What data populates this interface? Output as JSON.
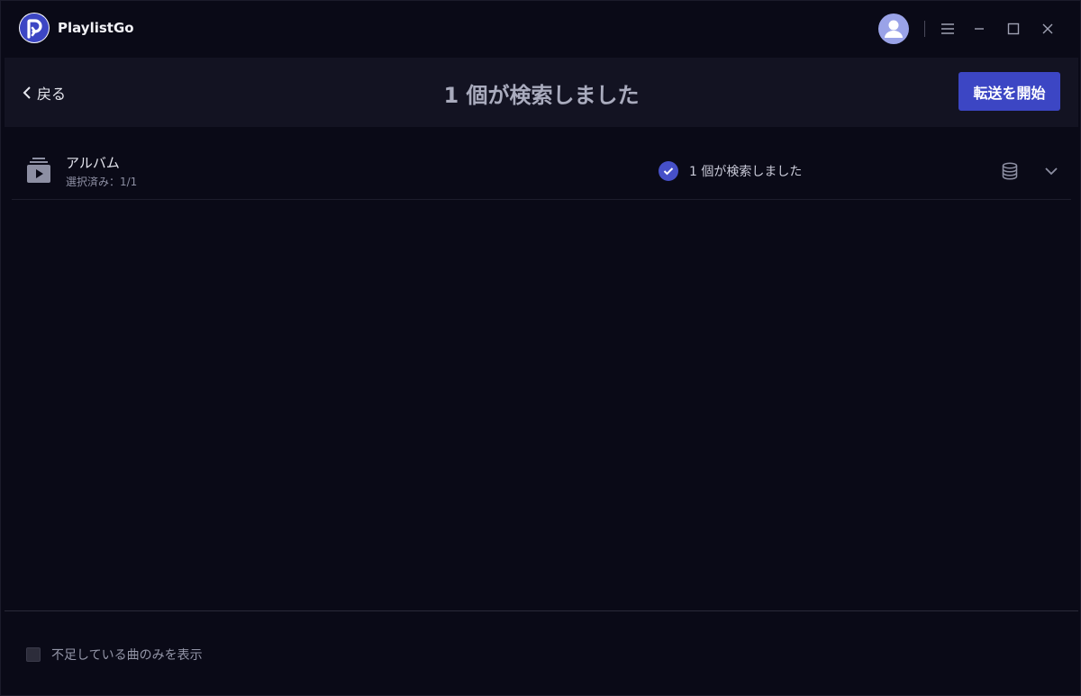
{
  "app": {
    "title": "PlaylistGo"
  },
  "titlebar": {
    "icons": [
      "avatar-icon",
      "menu-icon",
      "minimize-icon",
      "maximize-icon",
      "close-icon"
    ]
  },
  "header": {
    "back_label": "戻る",
    "title": "1 個が検索しました",
    "start_button": "転送を開始"
  },
  "album_row": {
    "title": "アルバム",
    "subtitle": "選択済み：1/1",
    "status": "1 個が検索しました"
  },
  "footer": {
    "checkbox_label": "不足している曲のみを表示",
    "checked": false
  },
  "colors": {
    "background": "#0a0a17",
    "header": "#131322",
    "accent": "#3c46c4",
    "check": "#4650c8"
  }
}
